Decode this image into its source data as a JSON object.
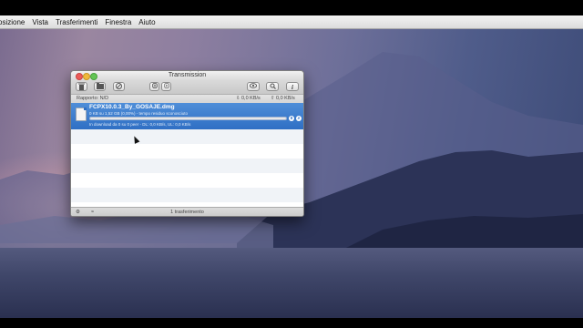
{
  "menubar": {
    "items": [
      "osizione",
      "Vista",
      "Trasferimenti",
      "Finestra",
      "Aiuto"
    ]
  },
  "window": {
    "title": "Transmission",
    "toolbar": {
      "remove_icon": "trash-icon",
      "open_icon": "folder-icon",
      "stop_icon": "no-entry-icon",
      "pause_icon": "pause-icon",
      "resume_icon": "resume-icon",
      "quicklook_icon": "eye-icon",
      "search_icon": "magnifier-icon",
      "info_icon": "info-icon",
      "info_glyph": "i"
    },
    "status": {
      "ratio": "Rapporto: N/D",
      "down": "0,0 KB/s",
      "up": "0,0 KB/s"
    },
    "transfer": {
      "name": "FCPX10.0.3_By_GOSAJE.dmg",
      "detail": "0 KB su 1,52 GB (0,00%) - tempo residuo sconosciuto",
      "status": "In download da 0 su 0 peer - DL: 0,0 KB/s, UL: 0,0 KB/s",
      "progress": 0.0
    },
    "footer": {
      "count": "1 trasferimento"
    }
  },
  "colors": {
    "selection": "#2f6fc4",
    "window_bg": "#ececec"
  }
}
